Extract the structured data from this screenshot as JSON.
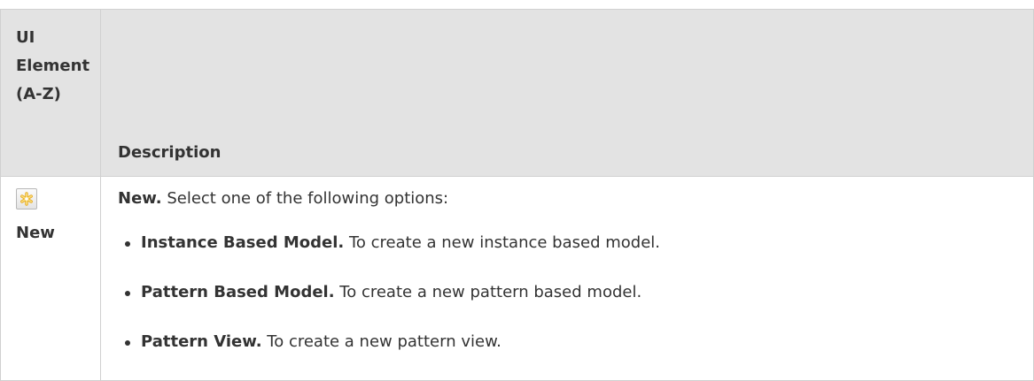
{
  "table": {
    "header": {
      "ui_element_lines": [
        "UI",
        "Element",
        "(A-Z)"
      ],
      "description": "Description"
    },
    "rows": [
      {
        "icon": "new-icon",
        "ui_element": "New",
        "intro_bold": "New.",
        "intro_text": " Select one of the following options:",
        "options": [
          {
            "title": "Instance Based Model.",
            "text": " To create a new instance based model."
          },
          {
            "title": "Pattern Based Model.",
            "text": " To create a new pattern based model."
          },
          {
            "title": "Pattern View.",
            "text": " To create a new pattern view."
          }
        ]
      }
    ]
  },
  "colors": {
    "header_bg": "#e3e3e3",
    "border": "#d0d0d0",
    "text": "#333333",
    "icon_accent": "#f3c64a"
  }
}
